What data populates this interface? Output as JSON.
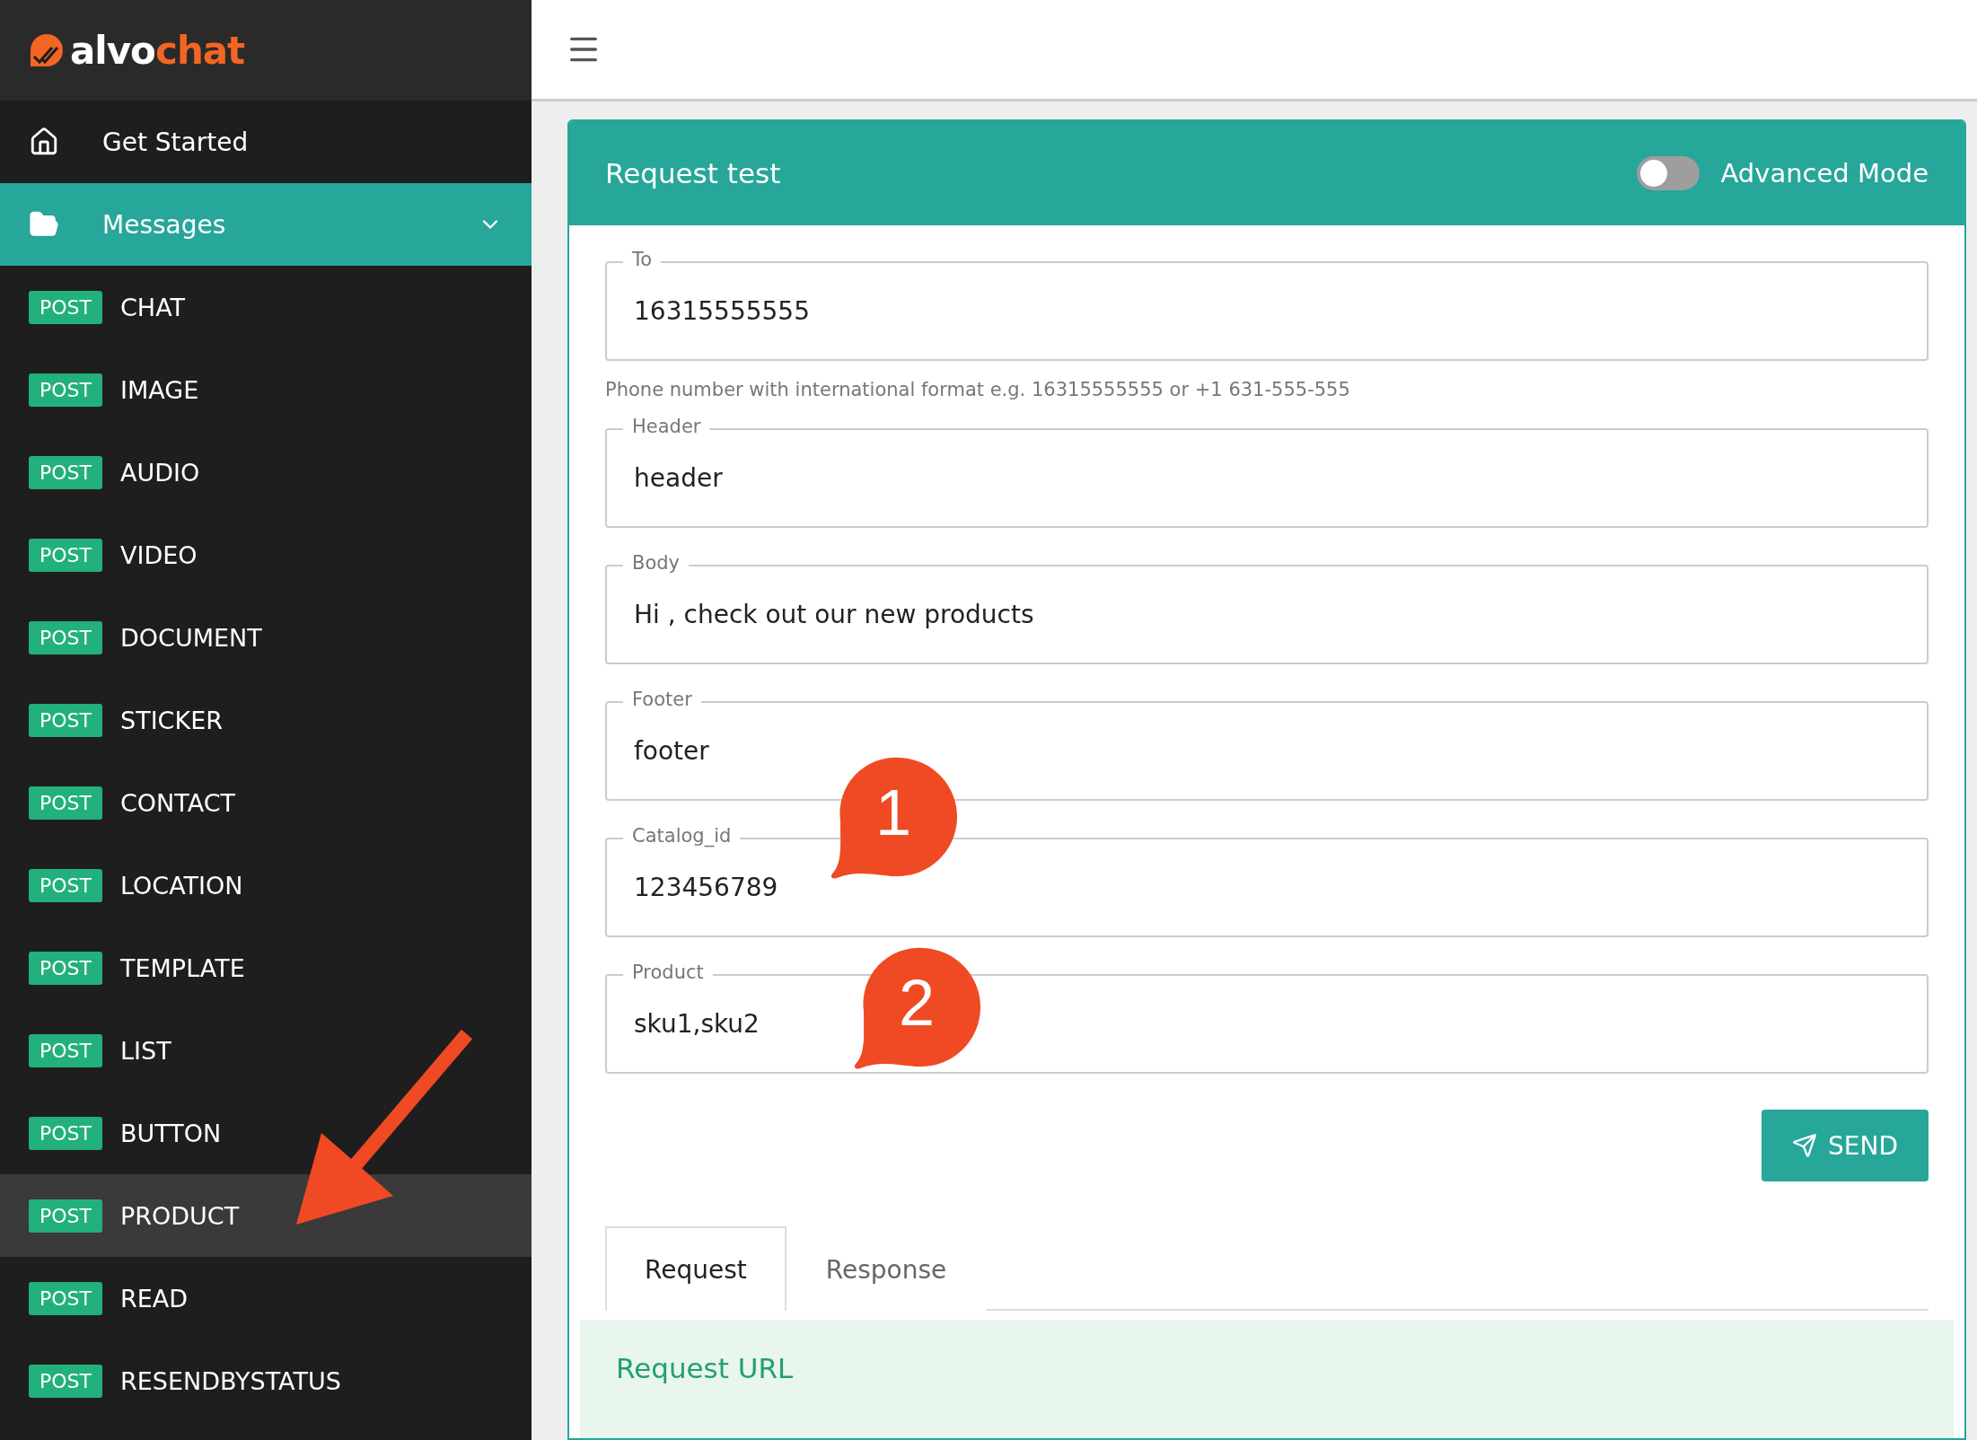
{
  "logo": {
    "part_1": "alvo",
    "part_2": "chat"
  },
  "sidebar": {
    "items": [
      {
        "label": "Get Started",
        "kind": "home",
        "selected": false
      },
      {
        "label": "Messages",
        "kind": "folder",
        "selected": true,
        "expanded": true,
        "children": [
          {
            "method": "POST",
            "label": "CHAT",
            "selected": false
          },
          {
            "method": "POST",
            "label": "IMAGE",
            "selected": false
          },
          {
            "method": "POST",
            "label": "AUDIO",
            "selected": false
          },
          {
            "method": "POST",
            "label": "VIDEO",
            "selected": false
          },
          {
            "method": "POST",
            "label": "DOCUMENT",
            "selected": false
          },
          {
            "method": "POST",
            "label": "STICKER",
            "selected": false
          },
          {
            "method": "POST",
            "label": "CONTACT",
            "selected": false
          },
          {
            "method": "POST",
            "label": "LOCATION",
            "selected": false
          },
          {
            "method": "POST",
            "label": "TEMPLATE",
            "selected": false
          },
          {
            "method": "POST",
            "label": "LIST",
            "selected": false
          },
          {
            "method": "POST",
            "label": "BUTTON",
            "selected": false
          },
          {
            "method": "POST",
            "label": "PRODUCT",
            "selected": true
          },
          {
            "method": "POST",
            "label": "READ",
            "selected": false
          },
          {
            "method": "POST",
            "label": "RESENDBYSTATUS",
            "selected": false
          }
        ]
      }
    ]
  },
  "card": {
    "title": "Request test",
    "advanced_mode": {
      "label": "Advanced Mode",
      "on": false
    },
    "fields": [
      {
        "label": "To",
        "value": "16315555555",
        "hint": "Phone number with international format e.g. 16315555555 or +1 631-555-555"
      },
      {
        "label": "Header",
        "value": "header"
      },
      {
        "label": "Body",
        "value": "Hi , check out our new products"
      },
      {
        "label": "Footer",
        "value": "footer"
      },
      {
        "label": "Catalog_id",
        "value": "123456789"
      },
      {
        "label": "Product",
        "value": "sku1,sku2"
      }
    ],
    "send_button": "SEND",
    "tabs": [
      {
        "label": "Request",
        "selected": true
      },
      {
        "label": "Response",
        "selected": false
      }
    ],
    "panel_title": "Request URL"
  },
  "annotations": [
    {
      "label": "1"
    },
    {
      "label": "2"
    }
  ]
}
